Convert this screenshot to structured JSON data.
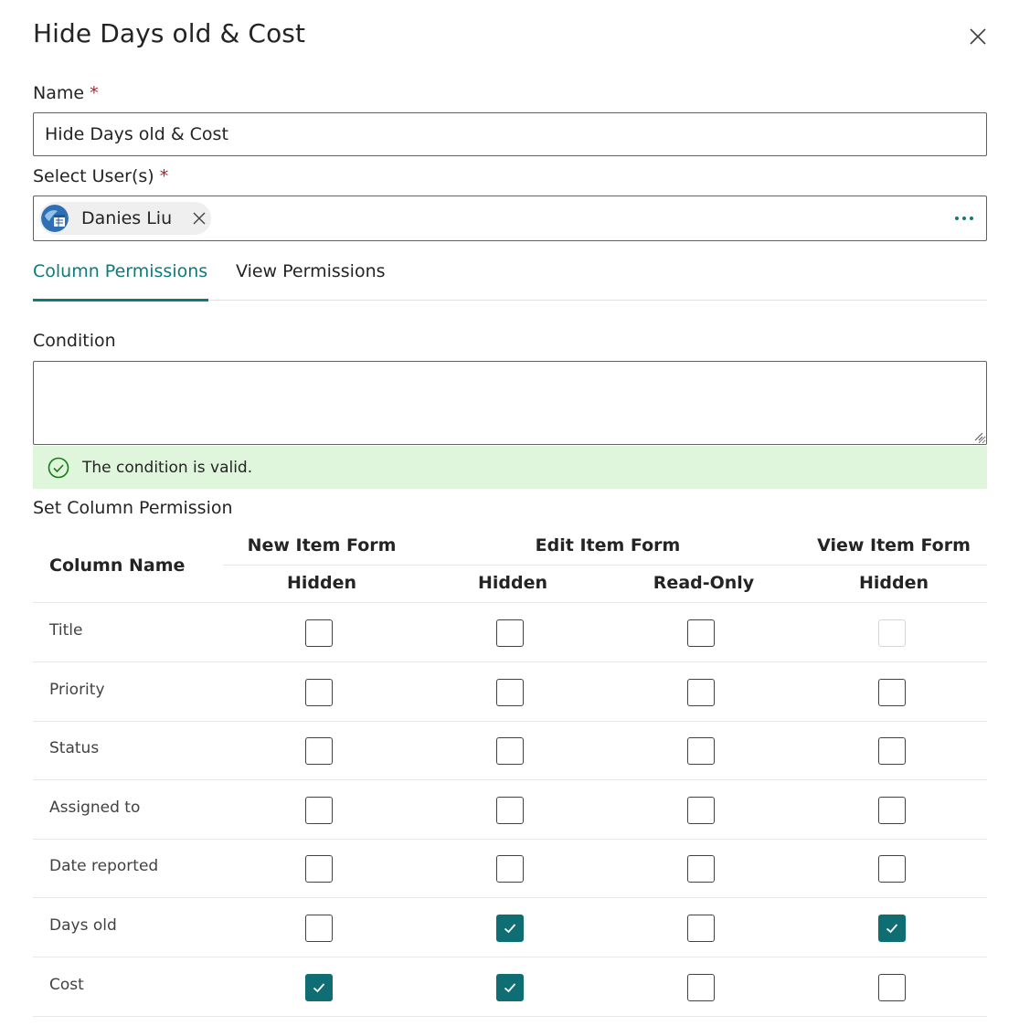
{
  "panel": {
    "title": "Hide Days old & Cost"
  },
  "form": {
    "name_label": "Name",
    "required_mark": "*",
    "name_value": "Hide Days old & Cost",
    "users_label": "Select User(s)",
    "selected_user": "Danies Liu",
    "more_icon": "more-horizontal-icon"
  },
  "tabs": [
    {
      "label": "Column Permissions",
      "active": true
    },
    {
      "label": "View Permissions",
      "active": false
    }
  ],
  "condition": {
    "label": "Condition",
    "value": "",
    "validation_message": "The condition is valid."
  },
  "permissions": {
    "section_title": "Set Column Permission",
    "column_name_header": "Column Name",
    "groups": [
      "New Item Form",
      "Edit Item Form",
      "View Item Form"
    ],
    "subheaders": [
      "Hidden",
      "Hidden",
      "Read-Only",
      "Hidden"
    ],
    "rows": [
      {
        "name": "Title",
        "checks": [
          false,
          false,
          false,
          false
        ],
        "disabled": [
          false,
          false,
          false,
          true
        ]
      },
      {
        "name": "Priority",
        "checks": [
          false,
          false,
          false,
          false
        ],
        "disabled": [
          false,
          false,
          false,
          false
        ]
      },
      {
        "name": "Status",
        "checks": [
          false,
          false,
          false,
          false
        ],
        "disabled": [
          false,
          false,
          false,
          false
        ]
      },
      {
        "name": "Assigned to",
        "checks": [
          false,
          false,
          false,
          false
        ],
        "disabled": [
          false,
          false,
          false,
          false
        ]
      },
      {
        "name": "Date reported",
        "checks": [
          false,
          false,
          false,
          false
        ],
        "disabled": [
          false,
          false,
          false,
          false
        ]
      },
      {
        "name": "Days old",
        "checks": [
          false,
          true,
          false,
          true
        ],
        "disabled": [
          false,
          false,
          false,
          false
        ]
      },
      {
        "name": "Cost",
        "checks": [
          true,
          true,
          false,
          false
        ],
        "disabled": [
          false,
          false,
          false,
          false
        ]
      }
    ]
  },
  "colors": {
    "accent": "#0f7a7a",
    "checked": "#0f6e73",
    "valid_bg": "#dff6dd",
    "valid_icon": "#107c10",
    "required": "#a4262c"
  }
}
